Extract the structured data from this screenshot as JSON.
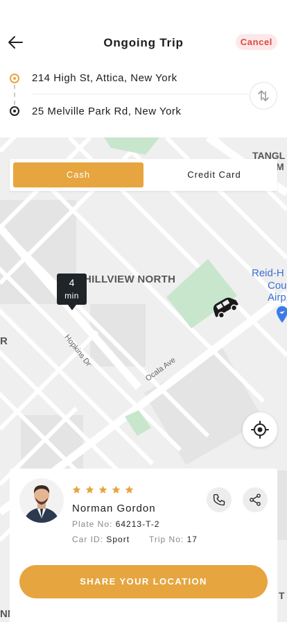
{
  "header": {
    "title": "Ongoing Trip",
    "cancel_label": "Cancel",
    "back_icon": "arrow-left-icon"
  },
  "route": {
    "from": "214 High St, Attica, New York",
    "to": "25 Melville Park Rd, New York",
    "swap_icon": "swap-vertical-icon"
  },
  "payment": {
    "options": [
      "Cash",
      "Credit Card"
    ],
    "selected": "Cash"
  },
  "map": {
    "labels": {
      "neighborhood": "HILLVIEW NORTH",
      "street_1": "Hopkins Dr",
      "street_2": "Ocala Ave",
      "airport_1": "Reid-H",
      "airport_2": "Cou",
      "airport_3": "Airp",
      "top_right_1": "TANGL",
      "top_right_2": "M",
      "left_edge": "R",
      "bottom_left": "NNINGHAM",
      "bottom_right": "T"
    },
    "eta": {
      "value": "4",
      "unit": "min"
    }
  },
  "driver": {
    "name": "Norman Gordon",
    "rating": 5,
    "plate_label": "Plate No:",
    "plate_value": "64213-T-2",
    "car_label": "Car ID:",
    "car_value": "Sport",
    "trip_label": "Trip No:",
    "trip_value": "17"
  },
  "actions": {
    "share_location": "SHARE YOUR LOCATION"
  },
  "colors": {
    "accent": "#e6a53f",
    "cancel_text": "#e04848",
    "cancel_bg": "#fde8e8",
    "park": "#c8e6cc",
    "airport_label": "#3b6fd4"
  }
}
